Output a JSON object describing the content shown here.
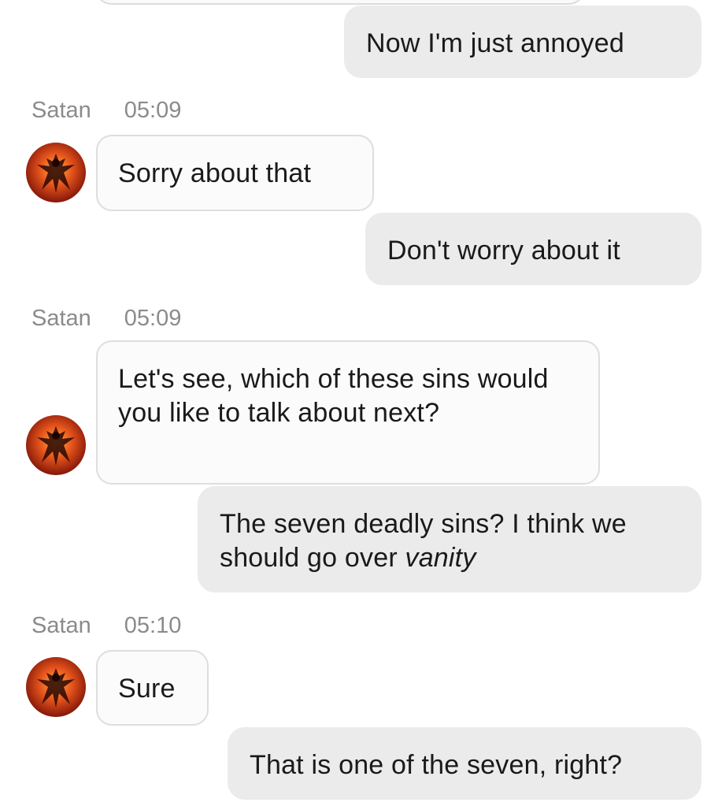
{
  "contact": {
    "name": "Satan",
    "avatar_icon": "demon-avatar-icon"
  },
  "messages": [
    {
      "from": "me",
      "text": "Now I'm just annoyed"
    },
    {
      "from": "Satan",
      "time": "05:09",
      "text": "Sorry about that"
    },
    {
      "from": "me",
      "text": "Don't worry about it"
    },
    {
      "from": "Satan",
      "time": "05:09",
      "text": "Let's see, which of these sins would you like to talk about next?"
    },
    {
      "from": "me",
      "text": "The seven deadly sins? I think we should go over ",
      "emphasis": "vanity"
    },
    {
      "from": "Satan",
      "time": "05:10",
      "text": "Sure"
    },
    {
      "from": "me",
      "text": "That is one of the seven, right?"
    }
  ],
  "colors": {
    "sent_bubble": "#ebebeb",
    "received_bubble": "#fbfbfb",
    "received_border": "#dedede",
    "meta_text": "#8b8b8b"
  }
}
